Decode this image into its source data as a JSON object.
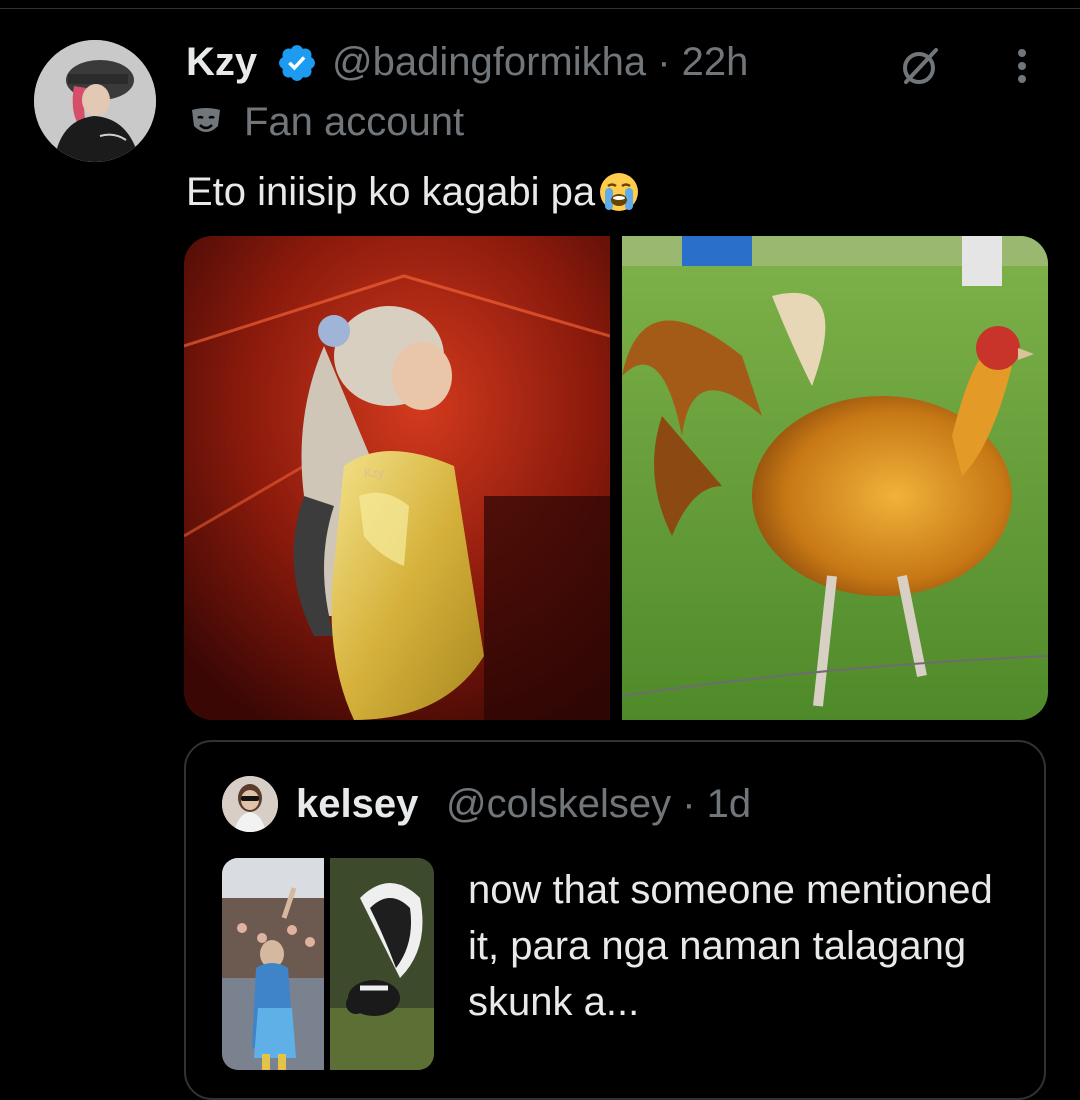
{
  "tweet": {
    "display_name": "Kzy",
    "handle_time": "@badingformikha · 22h",
    "label": "Fan account",
    "text": "Eto iniisip ko kagabi pa",
    "emoji": "loudly-crying-face",
    "media_watermark": "Kzy"
  },
  "quoted_tweet": {
    "display_name": "kelsey",
    "handle_time": "@colskelsey · 1d",
    "text": "now that someone mentioned it, para nga naman talagang skunk a..."
  },
  "icons": {
    "verified": "verified-badge-icon",
    "grok": "grok-icon",
    "more": "more-icon",
    "label": "theater-mask-icon"
  },
  "colors": {
    "background": "#000000",
    "primary_text": "#e7e9ea",
    "secondary_text": "#71767b",
    "border": "#2f3336",
    "verified_blue": "#1d9bf0"
  }
}
